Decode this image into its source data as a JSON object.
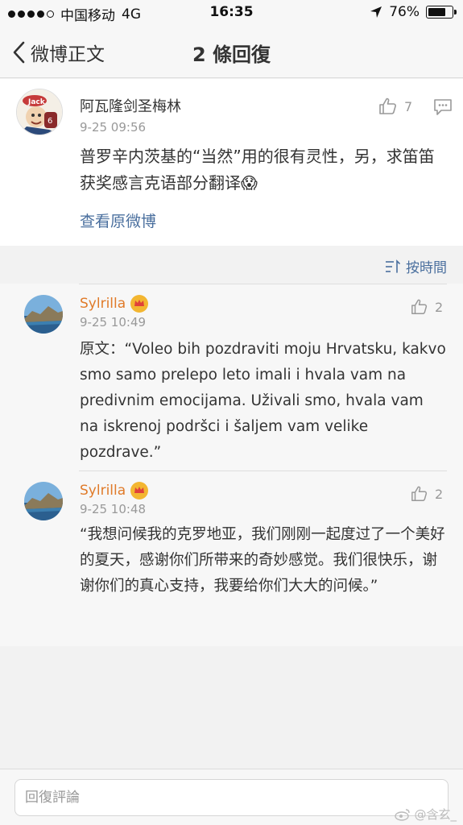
{
  "status_bar": {
    "carrier": "中国移动",
    "network": "4G",
    "time": "16:35",
    "battery": "76%",
    "battery_level": 0.76,
    "signal_bars_filled": 4,
    "signal_bars_total": 5
  },
  "nav": {
    "back_label": "微博正文",
    "title": "2 條回復"
  },
  "main_comment": {
    "author": "阿瓦隆剑圣梅林",
    "time": "9-25 09:56",
    "like_count": "7",
    "text": "普罗辛内茨基的“当然”用的很有灵性，另，求笛笛获奖感言克语部分翻译😱",
    "view_original": "查看原微博"
  },
  "sort": {
    "label": "按時間"
  },
  "replies": [
    {
      "author": "Sylrilla",
      "time": "9-25 10:49",
      "like_count": "2",
      "text": "原文：“Voleo bih pozdraviti moju Hrvatsku, kakvo smo samo prelepo leto imali i hvala vam na predivnim emocijama. Uživali smo, hvala vam na iskrenoj podršci i šaljem vam velike pozdrave.”"
    },
    {
      "author": "Sylrilla",
      "time": "9-25 10:48",
      "like_count": "2",
      "text": "“我想问候我的克罗地亚，我们刚刚一起度过了一个美好的夏天，感谢你们所带来的奇妙感觉。我们很快乐，谢谢你们的真心支持，我要给你们大大的问候。”"
    }
  ],
  "bottom": {
    "placeholder": "回復評論"
  },
  "watermark": "@含玄_",
  "colors": {
    "link": "#4a6f9e",
    "username": "#e07b2a",
    "crown": "#f3b631"
  }
}
